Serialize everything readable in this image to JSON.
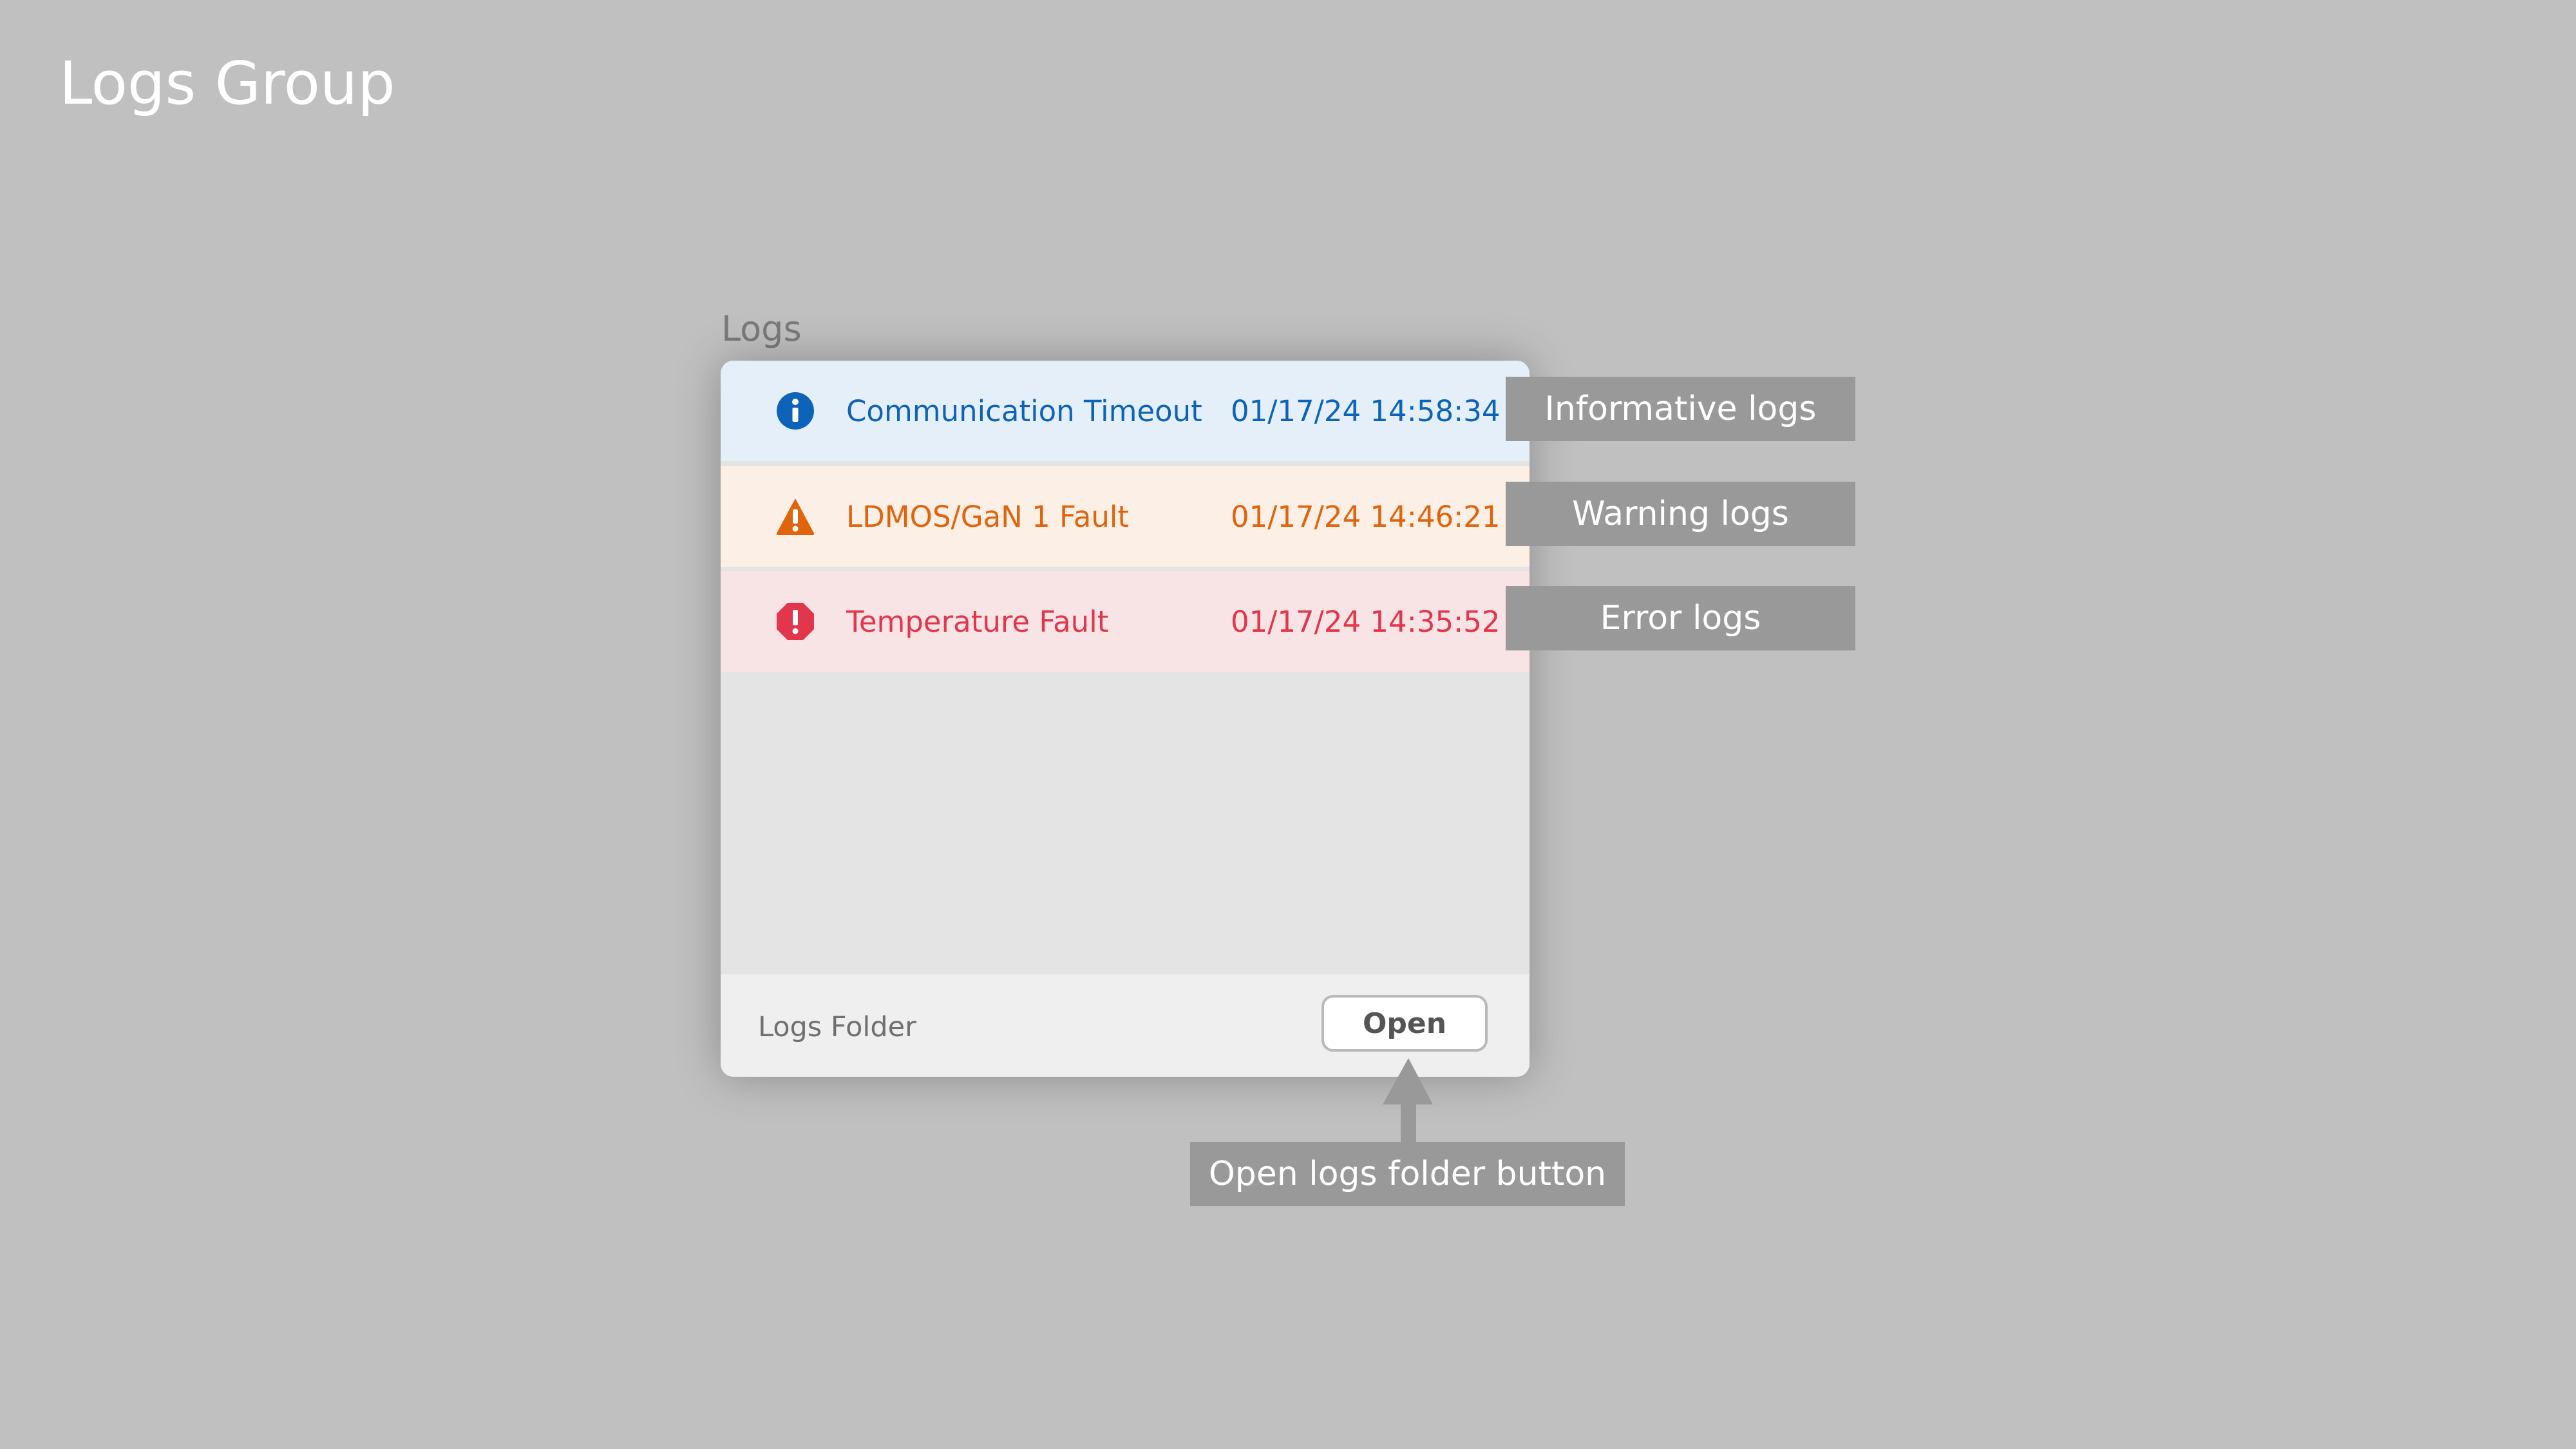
{
  "page": {
    "title": "Logs Group"
  },
  "panel": {
    "label": "Logs",
    "logs": [
      {
        "level": "info",
        "icon": "info-icon",
        "message": "Communication Timeout",
        "timestamp": "01/17/24 14:58:34",
        "text_color": "#0d63b8",
        "background": "#e5eff9"
      },
      {
        "level": "warning",
        "icon": "warning-icon",
        "message": "LDMOS/GaN 1 Fault",
        "timestamp": "01/17/24 14:46:21",
        "text_color": "#e0640c",
        "background": "#fcefe5"
      },
      {
        "level": "error",
        "icon": "error-icon",
        "message": "Temperature Fault",
        "timestamp": "01/17/24 14:35:52",
        "text_color": "#e2364c",
        "background": "#f8e3e5"
      }
    ],
    "footer": {
      "label": "Logs Folder",
      "button_label": "Open"
    }
  },
  "callouts": {
    "info": "Informative logs",
    "warning": "Warning logs",
    "error": "Error logs",
    "open_button": "Open logs folder button"
  },
  "colors": {
    "background": "#c0c0c0",
    "callout": "#9a9999",
    "panel_body": "#e4e4e4",
    "footer": "#efefef"
  }
}
